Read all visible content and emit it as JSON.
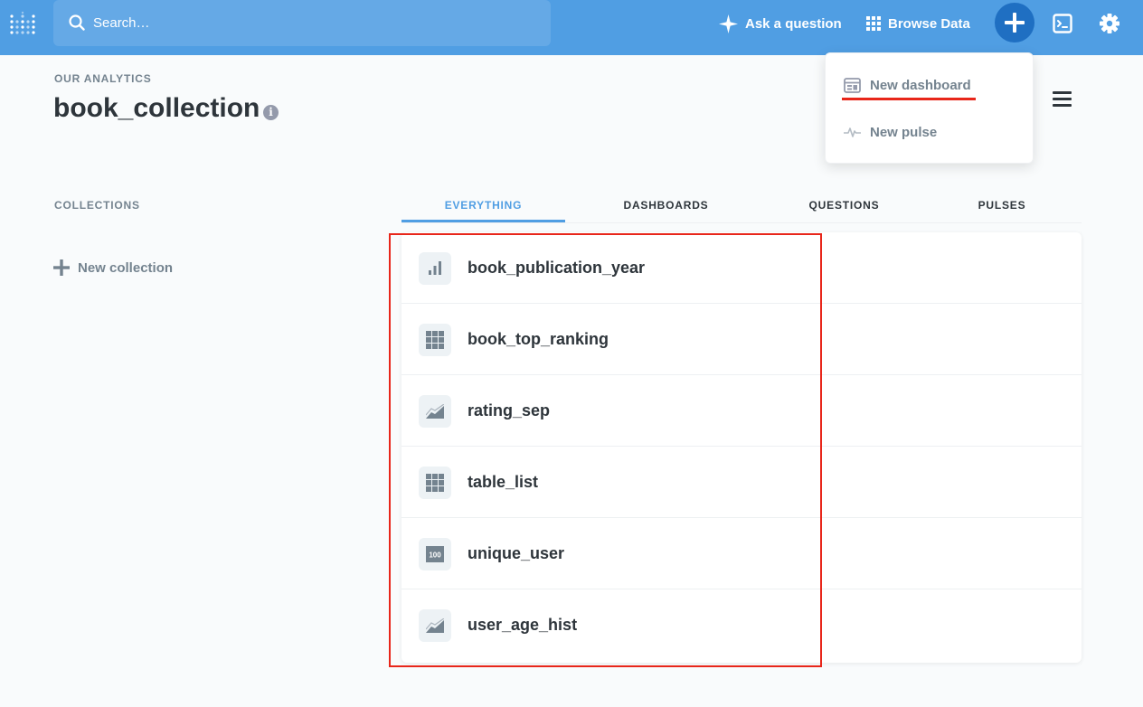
{
  "nav": {
    "logo_icon": "metabase-logo-icon",
    "search_placeholder": "Search…",
    "ask_label": "Ask a question",
    "browse_label": "Browse Data",
    "plus_icon": "plus-icon",
    "sql_icon": "sql-terminal-icon",
    "settings_icon": "gear-icon"
  },
  "header": {
    "eyebrow": "OUR ANALYTICS",
    "title": "book_collection"
  },
  "dropdown": {
    "items": [
      {
        "label": "New dashboard",
        "icon": "dashboard-icon"
      },
      {
        "label": "New pulse",
        "icon": "pulse-icon"
      }
    ]
  },
  "sidebar": {
    "collections_label": "COLLECTIONS",
    "new_collection_label": "New collection"
  },
  "tabs": [
    {
      "label": "EVERYTHING",
      "active": true
    },
    {
      "label": "DASHBOARDS",
      "active": false
    },
    {
      "label": "QUESTIONS",
      "active": false
    },
    {
      "label": "PULSES",
      "active": false
    }
  ],
  "items": [
    {
      "name": "book_publication_year",
      "icon": "bar-chart-icon"
    },
    {
      "name": "book_top_ranking",
      "icon": "table-icon"
    },
    {
      "name": "rating_sep",
      "icon": "area-chart-icon"
    },
    {
      "name": "table_list",
      "icon": "table-icon"
    },
    {
      "name": "unique_user",
      "icon": "scalar-number-icon",
      "icon_text": "100"
    },
    {
      "name": "user_age_hist",
      "icon": "area-chart-icon"
    }
  ],
  "colors": {
    "brand": "#509ee3",
    "brand_dark": "#1f6fc2",
    "annotation_red": "#e8261a",
    "text_dark": "#2e353b",
    "text_medium": "#74838f"
  }
}
